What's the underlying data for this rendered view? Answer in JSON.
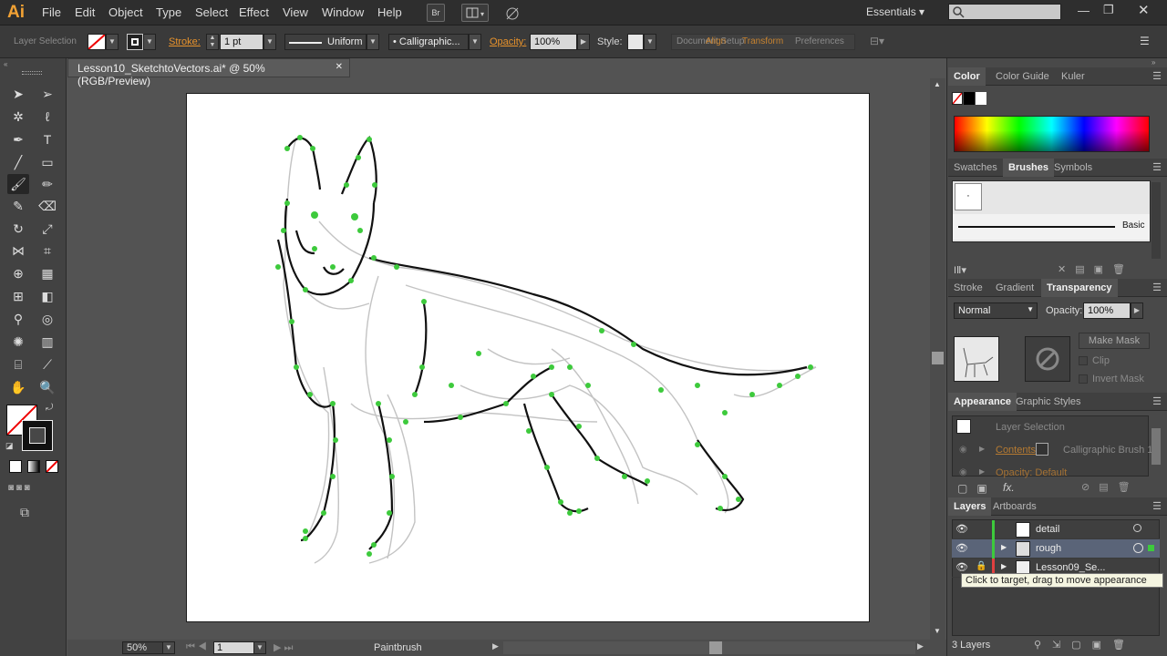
{
  "app": {
    "logo": "Ai",
    "menus": [
      "File",
      "Edit",
      "Object",
      "Type",
      "Select",
      "Effect",
      "View",
      "Window",
      "Help"
    ],
    "bridge": "Br",
    "workspace": "Essentials ▾"
  },
  "control": {
    "selection_label": "Layer Selection",
    "stroke_label": "Stroke:",
    "stroke_value": "1 pt",
    "profile": "Uniform",
    "brush": "Calligraphic...",
    "opacity_label": "Opacity:",
    "opacity_value": "100%",
    "style_label": "Style:",
    "doc_setup": "Document Setup",
    "align": "Align",
    "transform": "Transform",
    "preferences": "Preferences"
  },
  "document": {
    "tab_title": "Lesson10_SketchtoVectors.ai* @ 50% (RGB/Preview)",
    "zoom": "50%",
    "artboard": "1",
    "status_tool": "Paintbrush"
  },
  "color_panel": {
    "tabs": [
      "Color",
      "Color Guide",
      "Kuler"
    ]
  },
  "brushes_panel": {
    "tabs": [
      "Swatches",
      "Brushes",
      "Symbols"
    ],
    "basic_label": "Basic"
  },
  "transparency_panel": {
    "tabs": [
      "Stroke",
      "Gradient",
      "Transparency"
    ],
    "blend_mode": "Normal",
    "opacity_label": "Opacity:",
    "opacity_value": "100%",
    "make_mask": "Make Mask",
    "clip": "Clip",
    "invert_mask": "Invert Mask"
  },
  "appearance_panel": {
    "tabs": [
      "Appearance",
      "Graphic Styles"
    ],
    "header": "Layer Selection",
    "contents": "Contents",
    "contents_value": "Calligraphic Brush 1",
    "opacity_row": "Opacity: Default"
  },
  "layers_panel": {
    "tabs": [
      "Layers",
      "Artboards"
    ],
    "layers": [
      {
        "name": "detail"
      },
      {
        "name": "rough"
      },
      {
        "name": "Lesson09_Se..."
      }
    ],
    "tooltip": "Click to target, drag to move appearance",
    "count": "3 Layers"
  },
  "colors": {
    "accent_green": "#39c83a",
    "ai_orange": "#f2a234"
  }
}
